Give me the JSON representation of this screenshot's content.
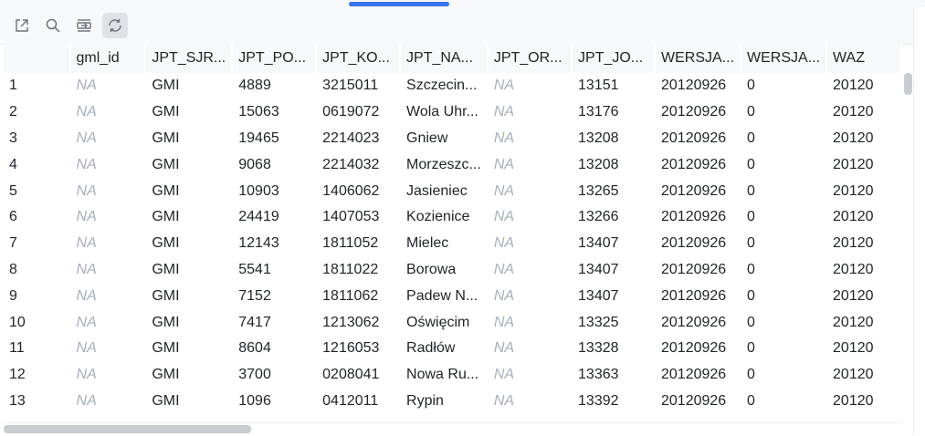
{
  "toolbar": {
    "buttons": [
      {
        "icon": "open-external-icon"
      },
      {
        "icon": "search-icon"
      },
      {
        "icon": "expand-columns-icon"
      },
      {
        "icon": "refresh-icon",
        "active": true
      }
    ]
  },
  "table": {
    "columns": [
      "",
      "gml_id",
      "JPT_SJR...",
      "JPT_PO...",
      "JPT_KO...",
      "JPT_NA...",
      "JPT_OR...",
      "JPT_JO...",
      "WERSJA...",
      "WERSJA...",
      "WAZ"
    ],
    "rows": [
      [
        "1",
        "NA",
        "GMI",
        "4889",
        "3215011",
        "Szczecin...",
        "NA",
        "13151",
        "20120926",
        "0",
        "20120"
      ],
      [
        "2",
        "NA",
        "GMI",
        "15063",
        "0619072",
        "Wola Uhr...",
        "NA",
        "13176",
        "20120926",
        "0",
        "20120"
      ],
      [
        "3",
        "NA",
        "GMI",
        "19465",
        "2214023",
        "Gniew",
        "NA",
        "13208",
        "20120926",
        "0",
        "20120"
      ],
      [
        "4",
        "NA",
        "GMI",
        "9068",
        "2214032",
        "Morzeszc...",
        "NA",
        "13208",
        "20120926",
        "0",
        "20120"
      ],
      [
        "5",
        "NA",
        "GMI",
        "10903",
        "1406062",
        "Jasieniec",
        "NA",
        "13265",
        "20120926",
        "0",
        "20120"
      ],
      [
        "6",
        "NA",
        "GMI",
        "24419",
        "1407053",
        "Kozienice",
        "NA",
        "13266",
        "20120926",
        "0",
        "20120"
      ],
      [
        "7",
        "NA",
        "GMI",
        "12143",
        "1811052",
        "Mielec",
        "NA",
        "13407",
        "20120926",
        "0",
        "20120"
      ],
      [
        "8",
        "NA",
        "GMI",
        "5541",
        "1811022",
        "Borowa",
        "NA",
        "13407",
        "20120926",
        "0",
        "20120"
      ],
      [
        "9",
        "NA",
        "GMI",
        "7152",
        "1811062",
        "Padew N...",
        "NA",
        "13407",
        "20120926",
        "0",
        "20120"
      ],
      [
        "10",
        "NA",
        "GMI",
        "7417",
        "1213062",
        "Oświęcim",
        "NA",
        "13325",
        "20120926",
        "0",
        "20120"
      ],
      [
        "11",
        "NA",
        "GMI",
        "8604",
        "1216053",
        "Radłów",
        "NA",
        "13328",
        "20120926",
        "0",
        "20120"
      ],
      [
        "12",
        "NA",
        "GMI",
        "3700",
        "0208041",
        "Nowa Ru...",
        "NA",
        "13363",
        "20120926",
        "0",
        "20120"
      ],
      [
        "13",
        "NA",
        "GMI",
        "1096",
        "0412011",
        "Rypin",
        "NA",
        "13392",
        "20120926",
        "0",
        "20120"
      ]
    ]
  }
}
